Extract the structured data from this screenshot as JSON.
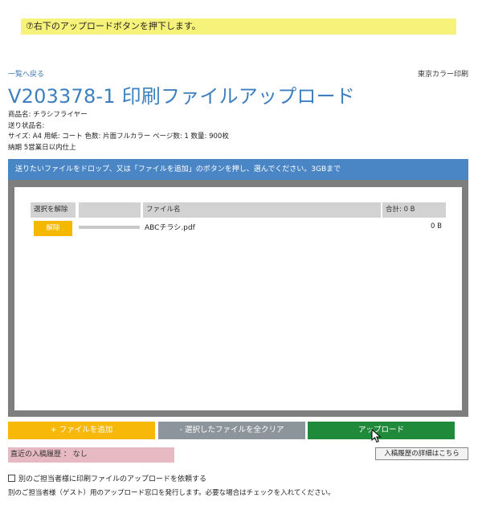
{
  "instruction": "⑦右下のアップロードボタンを押下します。",
  "back_link": "一覧へ戻る",
  "company": "東京カラー印刷",
  "page_title": "V203378-1 印刷ファイルアップロード",
  "info": {
    "product": "商品名: チラシフライヤー",
    "destination": "送り状品名:",
    "spec": "サイズ: A4 用紙: コート 色数: 片面フルカラー ページ数: 1 数量: 900枚",
    "delivery": "納期 5営業日以内仕上"
  },
  "drop_zone": {
    "header": "送りたいファイルをドロップ、又は「ファイルを追加」のボタンを押し、選んでください。3GBまで",
    "columns": {
      "select": "選択を解除",
      "progress": "",
      "name": "ファイル名",
      "total": "合計: 0 B"
    },
    "files": [
      {
        "unselect_label": "解除",
        "name": "ABCチラシ.pdf",
        "size": "0 B",
        "progress": 0
      }
    ]
  },
  "buttons": {
    "add": "+ ファイルを追加",
    "clear": "- 選択したファイルを全クリア",
    "upload": "アップロード"
  },
  "history": {
    "recent": "直近の入稿履歴 ： なし",
    "detail_button": "入稿履歴の詳細はこちら"
  },
  "guest": {
    "checkbox_label": "別のご担当者様に印刷ファイルのアップロードを依頼する",
    "checked": false,
    "note": "別のご担当者様（ゲスト）用のアップロード窓口を発行します。必要な場合はチェックを入れてください。"
  },
  "colors": {
    "title": "#3d7fbf",
    "header_bar": "#4a86c6",
    "add_button": "#f7b80a",
    "clear_button": "#8d959c",
    "upload_button": "#1e8a3a",
    "instruction_bg": "#f7f37a",
    "history_bg": "#e6b9c3"
  },
  "icons": {
    "cursor": "mouse-pointer-icon"
  }
}
